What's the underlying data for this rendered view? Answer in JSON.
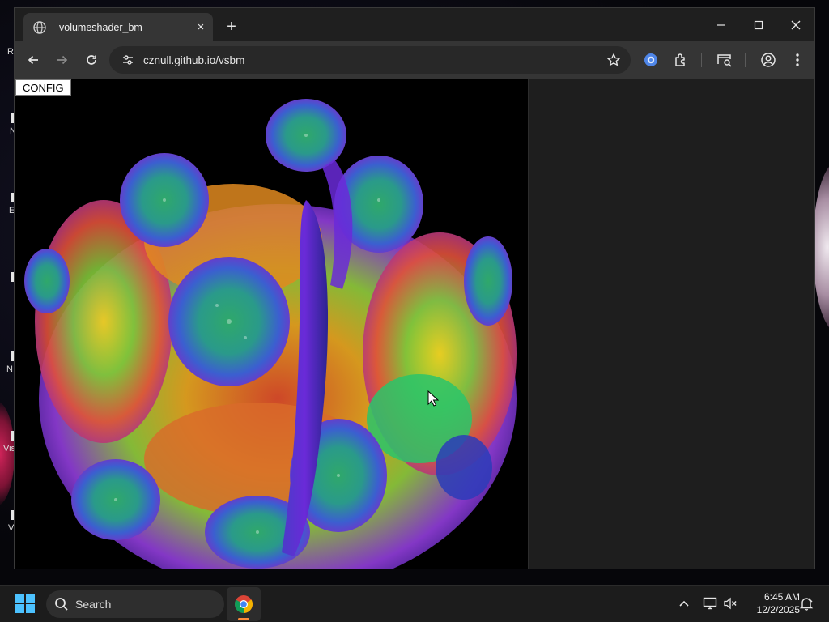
{
  "desktop": {
    "icon_labels": [
      "R",
      "N",
      "E",
      "N",
      "Vis",
      "V"
    ]
  },
  "browser": {
    "tab": {
      "title": "volumeshader_bm",
      "favicon": "globe-icon",
      "close": "×"
    },
    "new_tab": "+",
    "window_controls": [
      "minimize-icon",
      "maximize-icon",
      "close-icon"
    ],
    "toolbar": {
      "back": "back-arrow-icon",
      "forward": "forward-arrow-icon",
      "reload": "reload-icon",
      "site_info": "tune-icon",
      "url": "cznull.github.io/vsbm",
      "bookmark": "star-icon",
      "extensions": [
        "extension-badge-icon",
        "puzzle-icon",
        "tab-search-icon",
        "profile-icon",
        "more-menu-icon"
      ]
    }
  },
  "page": {
    "config_button": "CONFIG"
  },
  "taskbar": {
    "search_placeholder": "Search",
    "pinned": [
      "chrome-icon"
    ],
    "tray": [
      "chevron-up-icon",
      "network-icon",
      "volume-muted-icon",
      "notification-icon"
    ],
    "clock": {
      "time": "6:45 AM",
      "date": "12/2/2025"
    }
  }
}
